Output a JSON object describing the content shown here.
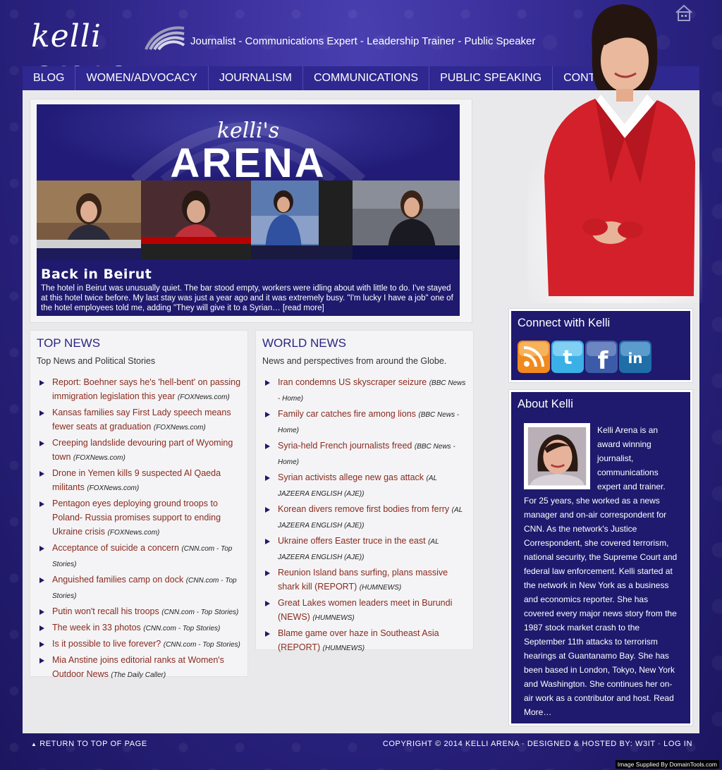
{
  "header": {
    "logo_text": "kelli arena",
    "tagline": "Journalist -  Communications Expert - Leadership Trainer - Public Speaker"
  },
  "nav": {
    "items": [
      {
        "label": "BLOG"
      },
      {
        "label": "WOMEN/ADVOCACY"
      },
      {
        "label": "JOURNALISM"
      },
      {
        "label": "COMMUNICATIONS"
      },
      {
        "label": "PUBLIC SPEAKING"
      },
      {
        "label": "CONTACT"
      }
    ]
  },
  "feature": {
    "banner_script": "kelli's",
    "banner_title": "ARENA",
    "title": "Back in Beirut",
    "body": "The hotel in Beirut was unusually quiet. The bar stood empty, workers were idling about with little to do. I've stayed at this hotel twice before. My last stay was just a year ago and it was extremely busy. \"I'm lucky I have a job\" one of the hotel employees told me, adding \"They will give it to a Syrian… ",
    "read_more": "[read more]"
  },
  "top_news": {
    "title": "TOP NEWS",
    "subtitle": "Top News and Political Stories",
    "items": [
      {
        "headline": "Report: Boehner says he's 'hell-bent' on passing immigration legislation this year",
        "source": "(FOXNews.com)"
      },
      {
        "headline": "Kansas families say First Lady speech means fewer seats at graduation",
        "source": "(FOXNews.com)"
      },
      {
        "headline": "Creeping landslide devouring part of Wyoming town",
        "source": "(FOXNews.com)"
      },
      {
        "headline": "Drone in Yemen kills 9 suspected Al Qaeda militants",
        "source": "(FOXNews.com)"
      },
      {
        "headline": "Pentagon eyes deploying ground troops to Poland- Russia promises support to ending Ukraine crisis",
        "source": "(FOXNews.com)"
      },
      {
        "headline": "Acceptance of suicide a concern",
        "source": "(CNN.com - Top Stories)"
      },
      {
        "headline": "Anguished families camp on dock",
        "source": "(CNN.com - Top Stories)"
      },
      {
        "headline": "Putin won't recall his troops",
        "source": "(CNN.com - Top Stories)"
      },
      {
        "headline": "The week in 33 photos",
        "source": "(CNN.com - Top Stories)"
      },
      {
        "headline": "Is it possible to live forever?",
        "source": "(CNN.com - Top Stories)"
      },
      {
        "headline": "Mia Anstine joins editorial ranks at Women's Outdoor News",
        "source": "(The Daily Caller)"
      }
    ]
  },
  "world_news": {
    "title": "WORLD NEWS",
    "subtitle": "News and perspectives from around the Globe.",
    "items": [
      {
        "headline": "Iran condemns US skyscraper seizure",
        "source": "(BBC News - Home)"
      },
      {
        "headline": "Family car catches fire among lions",
        "source": "(BBC News - Home)"
      },
      {
        "headline": "Syria-held French journalists freed",
        "source": "(BBC News - Home)"
      },
      {
        "headline": "Syrian activists allege new gas attack",
        "source": "(AL JAZEERA ENGLISH (AJE))"
      },
      {
        "headline": "Korean divers remove first bodies from ferry",
        "source": "(AL JAZEERA ENGLISH (AJE))"
      },
      {
        "headline": "Ukraine offers Easter truce in the east",
        "source": "(AL JAZEERA ENGLISH (AJE))"
      },
      {
        "headline": "Reunion Island bans surfing, plans massive shark kill (REPORT)",
        "source": "(HUMNEWS)"
      },
      {
        "headline": "Great Lakes women leaders meet in Burundi (NEWS)",
        "source": "(HUMNEWS)"
      },
      {
        "headline": "Blame game over haze in Southeast Asia (REPORT)",
        "source": "(HUMNEWS)"
      }
    ]
  },
  "connect": {
    "title": "Connect with Kelli",
    "icons": [
      "rss-icon",
      "twitter-icon",
      "facebook-icon",
      "linkedin-icon"
    ]
  },
  "about": {
    "title": "About Kelli",
    "text": "Kelli Arena is an award winning journalist, communications expert and trainer. For 25 years, she worked as a news manager and on-air correspondent for CNN. As the network's Justice Correspondent, she covered terrorism, national security, the Supreme Court and federal law enforcement. Kelli started at the network in New York as a business and economics reporter. She has covered every major news story from the 1987 stock market crash to the September 11th attacks to terrorism hearings at Guantanamo Bay. She has been based in London, Tokyo, New York and Washington. She continues her on-air work as a contributor and host. ",
    "read_more": "Read More…"
  },
  "footer": {
    "back_to_top": "RETURN TO TOP OF PAGE",
    "copyright": "COPYRIGHT © 2014 KELLI ARENA · DESIGNED & HOSTED BY: ",
    "designer": "W3IT",
    "sep": " · ",
    "login": "LOG IN"
  },
  "credit": "Image Supplied By DomainTools.com",
  "colors": {
    "brand_navy": "#1f1a6e",
    "link_red": "#8a2a1e",
    "panel_bg": "#f4f4f6"
  }
}
